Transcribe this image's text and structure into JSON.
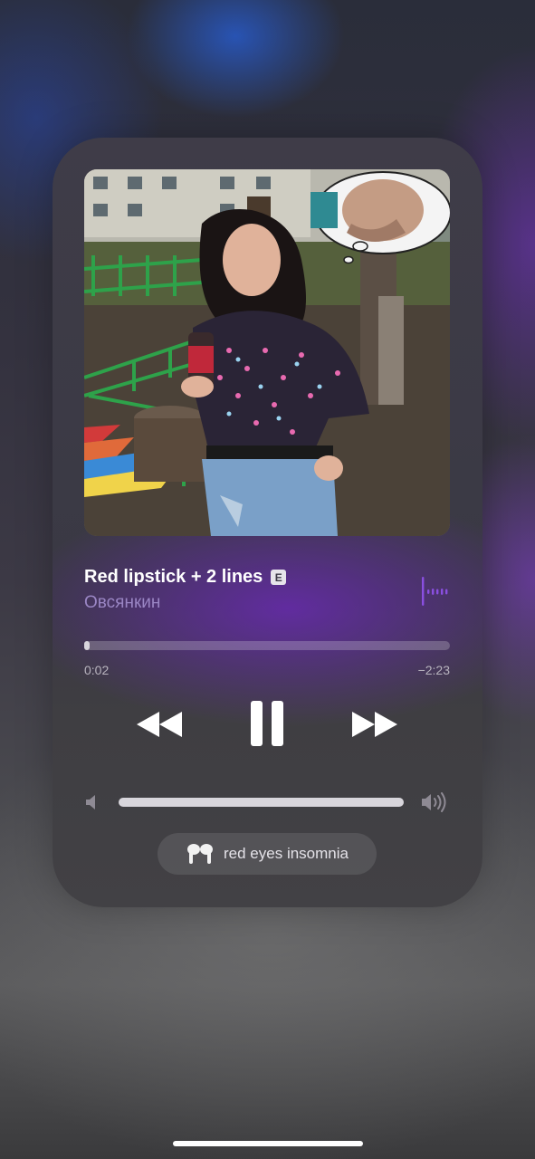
{
  "now_playing": {
    "title": "Red lipstick + 2 lines",
    "explicit_badge": "E",
    "artist": "Овсянкин",
    "elapsed": "0:02",
    "remaining": "−2:23",
    "progress": 0.014
  },
  "controls": {
    "rewind_icon": "backward-icon",
    "pause_icon": "pause-icon",
    "forward_icon": "forward-icon"
  },
  "volume": {
    "level": 1.0,
    "low_icon": "speaker-low-icon",
    "high_icon": "speaker-high-icon"
  },
  "output_device": {
    "name": "red eyes insomnia",
    "icon": "airpods-icon"
  },
  "colors": {
    "accent": "#8a4fe0",
    "artist_text": "#9a86c4"
  }
}
